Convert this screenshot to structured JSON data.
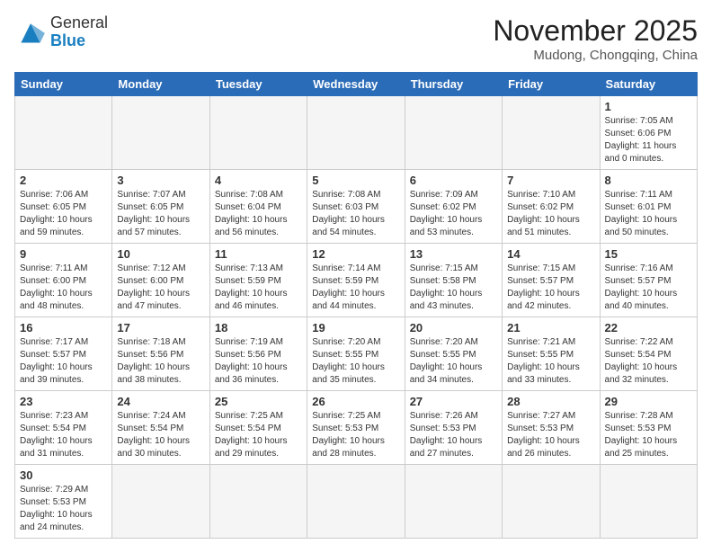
{
  "logo": {
    "general": "General",
    "blue": "Blue"
  },
  "title": "November 2025",
  "location": "Mudong, Chongqing, China",
  "weekdays": [
    "Sunday",
    "Monday",
    "Tuesday",
    "Wednesday",
    "Thursday",
    "Friday",
    "Saturday"
  ],
  "days": [
    {
      "day": "",
      "info": ""
    },
    {
      "day": "",
      "info": ""
    },
    {
      "day": "",
      "info": ""
    },
    {
      "day": "",
      "info": ""
    },
    {
      "day": "",
      "info": ""
    },
    {
      "day": "",
      "info": ""
    },
    {
      "day": "1",
      "info": "Sunrise: 7:05 AM\nSunset: 6:06 PM\nDaylight: 11 hours and 0 minutes."
    },
    {
      "day": "2",
      "info": "Sunrise: 7:06 AM\nSunset: 6:05 PM\nDaylight: 10 hours and 59 minutes."
    },
    {
      "day": "3",
      "info": "Sunrise: 7:07 AM\nSunset: 6:05 PM\nDaylight: 10 hours and 57 minutes."
    },
    {
      "day": "4",
      "info": "Sunrise: 7:08 AM\nSunset: 6:04 PM\nDaylight: 10 hours and 56 minutes."
    },
    {
      "day": "5",
      "info": "Sunrise: 7:08 AM\nSunset: 6:03 PM\nDaylight: 10 hours and 54 minutes."
    },
    {
      "day": "6",
      "info": "Sunrise: 7:09 AM\nSunset: 6:02 PM\nDaylight: 10 hours and 53 minutes."
    },
    {
      "day": "7",
      "info": "Sunrise: 7:10 AM\nSunset: 6:02 PM\nDaylight: 10 hours and 51 minutes."
    },
    {
      "day": "8",
      "info": "Sunrise: 7:11 AM\nSunset: 6:01 PM\nDaylight: 10 hours and 50 minutes."
    },
    {
      "day": "9",
      "info": "Sunrise: 7:11 AM\nSunset: 6:00 PM\nDaylight: 10 hours and 48 minutes."
    },
    {
      "day": "10",
      "info": "Sunrise: 7:12 AM\nSunset: 6:00 PM\nDaylight: 10 hours and 47 minutes."
    },
    {
      "day": "11",
      "info": "Sunrise: 7:13 AM\nSunset: 5:59 PM\nDaylight: 10 hours and 46 minutes."
    },
    {
      "day": "12",
      "info": "Sunrise: 7:14 AM\nSunset: 5:59 PM\nDaylight: 10 hours and 44 minutes."
    },
    {
      "day": "13",
      "info": "Sunrise: 7:15 AM\nSunset: 5:58 PM\nDaylight: 10 hours and 43 minutes."
    },
    {
      "day": "14",
      "info": "Sunrise: 7:15 AM\nSunset: 5:57 PM\nDaylight: 10 hours and 42 minutes."
    },
    {
      "day": "15",
      "info": "Sunrise: 7:16 AM\nSunset: 5:57 PM\nDaylight: 10 hours and 40 minutes."
    },
    {
      "day": "16",
      "info": "Sunrise: 7:17 AM\nSunset: 5:57 PM\nDaylight: 10 hours and 39 minutes."
    },
    {
      "day": "17",
      "info": "Sunrise: 7:18 AM\nSunset: 5:56 PM\nDaylight: 10 hours and 38 minutes."
    },
    {
      "day": "18",
      "info": "Sunrise: 7:19 AM\nSunset: 5:56 PM\nDaylight: 10 hours and 36 minutes."
    },
    {
      "day": "19",
      "info": "Sunrise: 7:20 AM\nSunset: 5:55 PM\nDaylight: 10 hours and 35 minutes."
    },
    {
      "day": "20",
      "info": "Sunrise: 7:20 AM\nSunset: 5:55 PM\nDaylight: 10 hours and 34 minutes."
    },
    {
      "day": "21",
      "info": "Sunrise: 7:21 AM\nSunset: 5:55 PM\nDaylight: 10 hours and 33 minutes."
    },
    {
      "day": "22",
      "info": "Sunrise: 7:22 AM\nSunset: 5:54 PM\nDaylight: 10 hours and 32 minutes."
    },
    {
      "day": "23",
      "info": "Sunrise: 7:23 AM\nSunset: 5:54 PM\nDaylight: 10 hours and 31 minutes."
    },
    {
      "day": "24",
      "info": "Sunrise: 7:24 AM\nSunset: 5:54 PM\nDaylight: 10 hours and 30 minutes."
    },
    {
      "day": "25",
      "info": "Sunrise: 7:25 AM\nSunset: 5:54 PM\nDaylight: 10 hours and 29 minutes."
    },
    {
      "day": "26",
      "info": "Sunrise: 7:25 AM\nSunset: 5:53 PM\nDaylight: 10 hours and 28 minutes."
    },
    {
      "day": "27",
      "info": "Sunrise: 7:26 AM\nSunset: 5:53 PM\nDaylight: 10 hours and 27 minutes."
    },
    {
      "day": "28",
      "info": "Sunrise: 7:27 AM\nSunset: 5:53 PM\nDaylight: 10 hours and 26 minutes."
    },
    {
      "day": "29",
      "info": "Sunrise: 7:28 AM\nSunset: 5:53 PM\nDaylight: 10 hours and 25 minutes."
    },
    {
      "day": "30",
      "info": "Sunrise: 7:29 AM\nSunset: 5:53 PM\nDaylight: 10 hours and 24 minutes."
    },
    {
      "day": "",
      "info": ""
    },
    {
      "day": "",
      "info": ""
    },
    {
      "day": "",
      "info": ""
    },
    {
      "day": "",
      "info": ""
    },
    {
      "day": "",
      "info": ""
    },
    {
      "day": "",
      "info": ""
    }
  ]
}
